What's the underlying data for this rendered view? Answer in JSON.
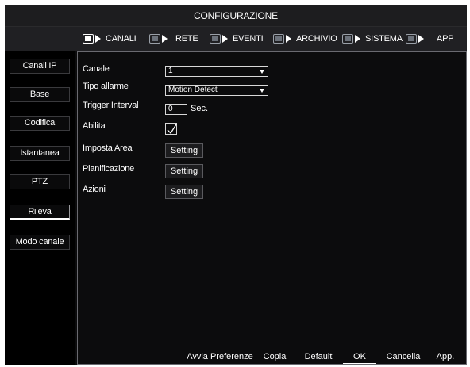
{
  "window": {
    "title": "CONFIGURAZIONE"
  },
  "tabs": [
    {
      "label": "CANALI",
      "icon": "camera-icon",
      "active": true
    },
    {
      "label": "RETE",
      "icon": "network-icon"
    },
    {
      "label": "EVENTI",
      "icon": "alarm-icon"
    },
    {
      "label": "ARCHIVIO",
      "icon": "storage-icon"
    },
    {
      "label": "SISTEMA",
      "icon": "system-icon"
    },
    {
      "label": "APP",
      "icon": "app-icon"
    }
  ],
  "sidebar": {
    "items": [
      {
        "label": "Canali IP"
      },
      {
        "label": "Base"
      },
      {
        "label": "Codifica"
      },
      {
        "label": "Istantanea"
      },
      {
        "label": "PTZ"
      },
      {
        "label": "Rileva",
        "active": true
      },
      {
        "label": "Modo canale"
      }
    ]
  },
  "form": {
    "canale_label": "Canale",
    "canale_value": "1",
    "tipo_allarme_label": "Tipo allarme",
    "tipo_allarme_value": "Motion Detect",
    "trigger_label": "Trigger Interval",
    "trigger_value": "0",
    "trigger_unit": "Sec.",
    "abilita_label": "Abilita",
    "abilita_checked": true,
    "area_label": "Imposta Area",
    "area_button": "Setting",
    "pianificazione_label": "Pianificazione",
    "pianificazione_button": "Setting",
    "azioni_label": "Azioni",
    "azioni_button": "Setting"
  },
  "footer": {
    "avvia": "Avvia Preferenze",
    "copia": "Copia",
    "default": "Default",
    "ok": "OK",
    "cancella": "Cancella",
    "app": "App."
  }
}
